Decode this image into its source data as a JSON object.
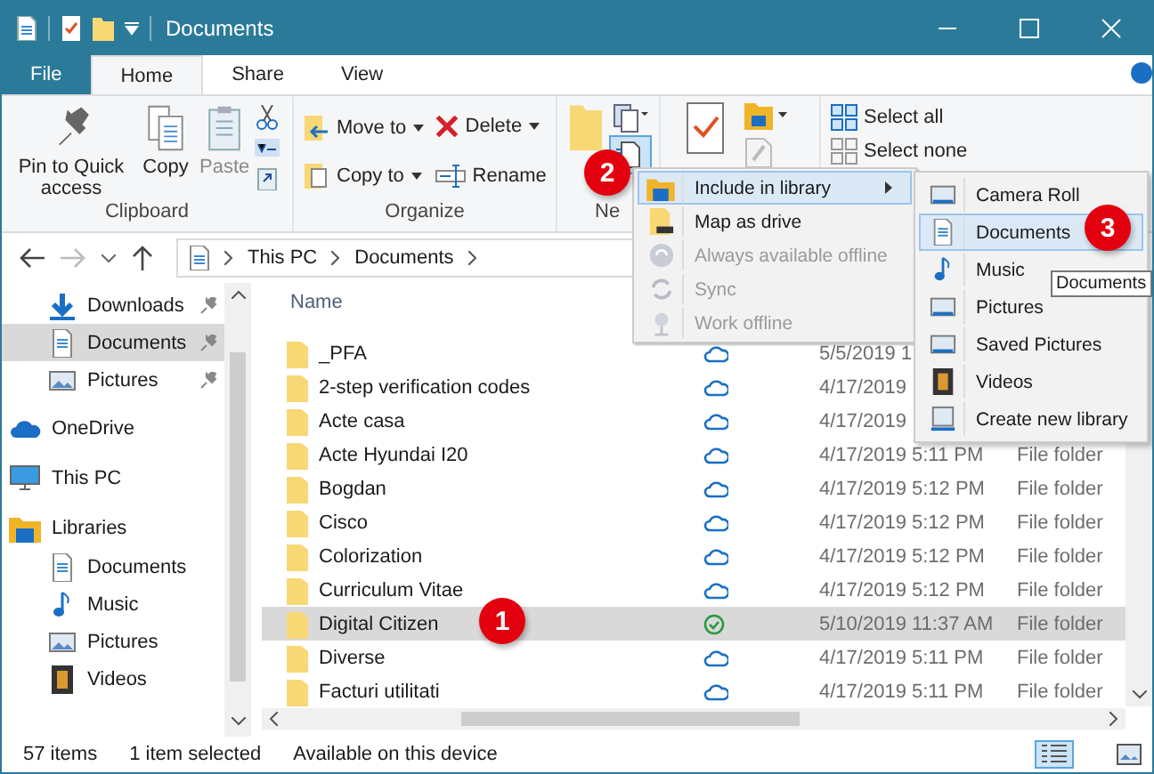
{
  "window": {
    "title": "Documents"
  },
  "ribbon_tabs": [
    {
      "label": "File",
      "kind": "file",
      "selected": false
    },
    {
      "label": "Home",
      "kind": "tab",
      "selected": true
    },
    {
      "label": "Share",
      "kind": "tab",
      "selected": false
    },
    {
      "label": "View",
      "kind": "tab",
      "selected": false
    }
  ],
  "ribbon": {
    "clipboard": {
      "label": "Clipboard",
      "commands": [
        {
          "label": "Pin to Quick access",
          "kind": "pin",
          "disabled": false
        },
        {
          "label": "Copy",
          "kind": "copy",
          "disabled": false
        },
        {
          "label": "Paste",
          "kind": "paste",
          "disabled": true
        }
      ]
    },
    "organize": {
      "label": "Organize",
      "commands": [
        {
          "label": "Move to",
          "kind": "move"
        },
        {
          "label": "Delete",
          "kind": "delete"
        },
        {
          "label": "Copy to",
          "kind": "copyto"
        },
        {
          "label": "Rename",
          "kind": "rename"
        }
      ]
    },
    "new": {
      "label": "Ne"
    },
    "select": {
      "commands": [
        {
          "label": "Select all",
          "kind": "all"
        },
        {
          "label": "Select none",
          "kind": "none"
        }
      ]
    }
  },
  "address": {
    "crumbs": [
      "This PC",
      "Documents"
    ]
  },
  "nav": {
    "pinned": [
      {
        "label": "Downloads",
        "kind": "downloads",
        "selected": false
      },
      {
        "label": "Documents",
        "kind": "documents",
        "selected": true
      },
      {
        "label": "Pictures",
        "kind": "pictures",
        "selected": false
      }
    ],
    "locations": [
      {
        "label": "OneDrive",
        "kind": "onedrive",
        "selected": false
      },
      {
        "label": "This PC",
        "kind": "pc",
        "selected": false
      },
      {
        "label": "Libraries",
        "kind": "libraries",
        "selected": false,
        "children": [
          {
            "label": "Documents",
            "kind": "documents",
            "selected": false
          },
          {
            "label": "Music",
            "kind": "music",
            "selected": false
          },
          {
            "label": "Pictures",
            "kind": "pictures",
            "selected": false
          },
          {
            "label": "Videos",
            "kind": "videos",
            "selected": false
          }
        ]
      }
    ]
  },
  "file_list": {
    "column_name": "Name",
    "rows": [
      {
        "name": "_PFA",
        "kind": "cloud",
        "date": "5/5/2019 1",
        "selected": false
      },
      {
        "name": "2-step verification codes",
        "kind": "cloud",
        "date": "4/17/2019",
        "selected": false
      },
      {
        "name": "Acte casa",
        "kind": "cloud",
        "date": "4/17/2019",
        "selected": false
      },
      {
        "name": "Acte Hyundai I20",
        "kind": "cloud",
        "date": "4/17/2019 5:11 PM",
        "type": "File folder",
        "selected": false
      },
      {
        "name": "Bogdan",
        "kind": "cloud",
        "date": "4/17/2019 5:12 PM",
        "type": "File folder",
        "selected": false
      },
      {
        "name": "Cisco",
        "kind": "cloud",
        "date": "4/17/2019 5:12 PM",
        "type": "File folder",
        "selected": false
      },
      {
        "name": "Colorization",
        "kind": "cloud",
        "date": "4/17/2019 5:12 PM",
        "type": "File folder",
        "selected": false
      },
      {
        "name": "Curriculum Vitae",
        "kind": "cloud",
        "date": "4/17/2019 5:12 PM",
        "type": "File folder",
        "selected": false
      },
      {
        "name": "Digital Citizen",
        "kind": "synced",
        "date": "5/10/2019 11:37 AM",
        "type": "File folder",
        "selected": true
      },
      {
        "name": "Diverse",
        "kind": "cloud",
        "date": "4/17/2019 5:11 PM",
        "type": "File folder",
        "selected": false
      },
      {
        "name": "Facturi utilitati",
        "kind": "cloud",
        "date": "4/17/2019 5:11 PM",
        "type": "File folder",
        "selected": false
      }
    ]
  },
  "status_bar": {
    "items": [
      "57 items",
      "1 item selected",
      "Available on this device"
    ],
    "views": [
      {
        "kind": "details",
        "selected": true
      },
      {
        "kind": "large-icons",
        "selected": false
      }
    ]
  },
  "menu": {
    "items": [
      {
        "label": "Include in library",
        "kind": "library",
        "submenu": true,
        "disabled": false,
        "highlighted": true
      },
      {
        "label": "Map as drive",
        "kind": "drive",
        "submenu": false,
        "disabled": false,
        "highlighted": false
      },
      {
        "label": "Always available offline",
        "kind": "offline",
        "submenu": false,
        "disabled": true,
        "highlighted": false
      },
      {
        "label": "Sync",
        "kind": "sync",
        "submenu": false,
        "disabled": true,
        "highlighted": false
      },
      {
        "label": "Work offline",
        "kind": "work",
        "submenu": false,
        "disabled": true,
        "highlighted": false
      }
    ]
  },
  "submenu": {
    "items": [
      {
        "label": "Camera Roll",
        "kind": "pictures",
        "highlighted": false
      },
      {
        "label": "Documents",
        "kind": "documents",
        "highlighted": true
      },
      {
        "label": "Music",
        "kind": "music",
        "highlighted": false
      },
      {
        "label": "Pictures",
        "kind": "pictures",
        "highlighted": false
      },
      {
        "label": "Saved Pictures",
        "kind": "pictures",
        "highlighted": false
      },
      {
        "label": "Videos",
        "kind": "videos",
        "highlighted": false
      },
      {
        "label": "Create new library",
        "kind": "new",
        "highlighted": false
      }
    ]
  },
  "tooltip": {
    "text": "Documents"
  },
  "step_badges": [
    "1",
    "2",
    "3"
  ]
}
